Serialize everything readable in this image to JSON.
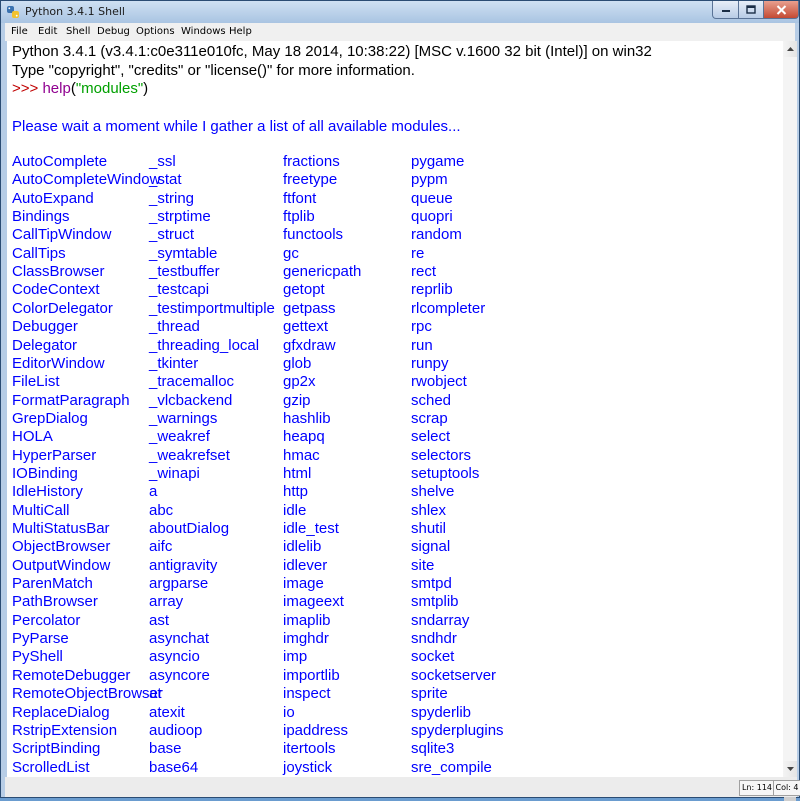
{
  "window": {
    "title": "Python 3.4.1 Shell"
  },
  "menu": [
    "File",
    "Edit",
    "Shell",
    "Debug",
    "Options",
    "Windows",
    "Help"
  ],
  "colors": {
    "output": "#0000ff",
    "prompt": "#c00000",
    "builtin": "#900090",
    "string": "#00a000"
  },
  "shell": {
    "banner_line1": "Python 3.4.1 (v3.4.1:c0e311e010fc, May 18 2014, 10:38:22) [MSC v.1600 32 bit (Intel)] on win32",
    "banner_line2": "Type \"copyright\", \"credits\" or \"license()\" for more information.",
    "prompt": ">>>",
    "command_func": "help",
    "command_open": "(",
    "command_arg": "\"modules\"",
    "command_close": ")",
    "wait_message": "Please wait a moment while I gather a list of all available modules...",
    "modules": [
      [
        "AutoComplete",
        "_ssl",
        "fractions",
        "pygame"
      ],
      [
        "AutoCompleteWindow",
        "_stat",
        "freetype",
        "pypm"
      ],
      [
        "AutoExpand",
        "_string",
        "ftfont",
        "queue"
      ],
      [
        "Bindings",
        "_strptime",
        "ftplib",
        "quopri"
      ],
      [
        "CallTipWindow",
        "_struct",
        "functools",
        "random"
      ],
      [
        "CallTips",
        "_symtable",
        "gc",
        "re"
      ],
      [
        "ClassBrowser",
        "_testbuffer",
        "genericpath",
        "rect"
      ],
      [
        "CodeContext",
        "_testcapi",
        "getopt",
        "reprlib"
      ],
      [
        "ColorDelegator",
        "_testimportmultiple",
        "getpass",
        "rlcompleter"
      ],
      [
        "Debugger",
        "_thread",
        "gettext",
        "rpc"
      ],
      [
        "Delegator",
        "_threading_local",
        "gfxdraw",
        "run"
      ],
      [
        "EditorWindow",
        "_tkinter",
        "glob",
        "runpy"
      ],
      [
        "FileList",
        "_tracemalloc",
        "gp2x",
        "rwobject"
      ],
      [
        "FormatParagraph",
        "_vlcbackend",
        "gzip",
        "sched"
      ],
      [
        "GrepDialog",
        "_warnings",
        "hashlib",
        "scrap"
      ],
      [
        "HOLA",
        "_weakref",
        "heapq",
        "select"
      ],
      [
        "HyperParser",
        "_weakrefset",
        "hmac",
        "selectors"
      ],
      [
        "IOBinding",
        "_winapi",
        "html",
        "setuptools"
      ],
      [
        "IdleHistory",
        "a",
        "http",
        "shelve"
      ],
      [
        "MultiCall",
        "abc",
        "idle",
        "shlex"
      ],
      [
        "MultiStatusBar",
        "aboutDialog",
        "idle_test",
        "shutil"
      ],
      [
        "ObjectBrowser",
        "aifc",
        "idlelib",
        "signal"
      ],
      [
        "OutputWindow",
        "antigravity",
        "idlever",
        "site"
      ],
      [
        "ParenMatch",
        "argparse",
        "image",
        "smtpd"
      ],
      [
        "PathBrowser",
        "array",
        "imageext",
        "smtplib"
      ],
      [
        "Percolator",
        "ast",
        "imaplib",
        "sndarray"
      ],
      [
        "PyParse",
        "asynchat",
        "imghdr",
        "sndhdr"
      ],
      [
        "PyShell",
        "asyncio",
        "imp",
        "socket"
      ],
      [
        "RemoteDebugger",
        "asyncore",
        "importlib",
        "socketserver"
      ],
      [
        "RemoteObjectBrowser",
        "at",
        "inspect",
        "sprite"
      ],
      [
        "ReplaceDialog",
        "atexit",
        "io",
        "spyderlib"
      ],
      [
        "RstripExtension",
        "audioop",
        "ipaddress",
        "spyderplugins"
      ],
      [
        "ScriptBinding",
        "base",
        "itertools",
        "sqlite3"
      ],
      [
        "ScrolledList",
        "base64",
        "joystick",
        "sre_compile"
      ]
    ]
  },
  "status": {
    "line": "Ln: 114",
    "col": "Col: 4"
  }
}
